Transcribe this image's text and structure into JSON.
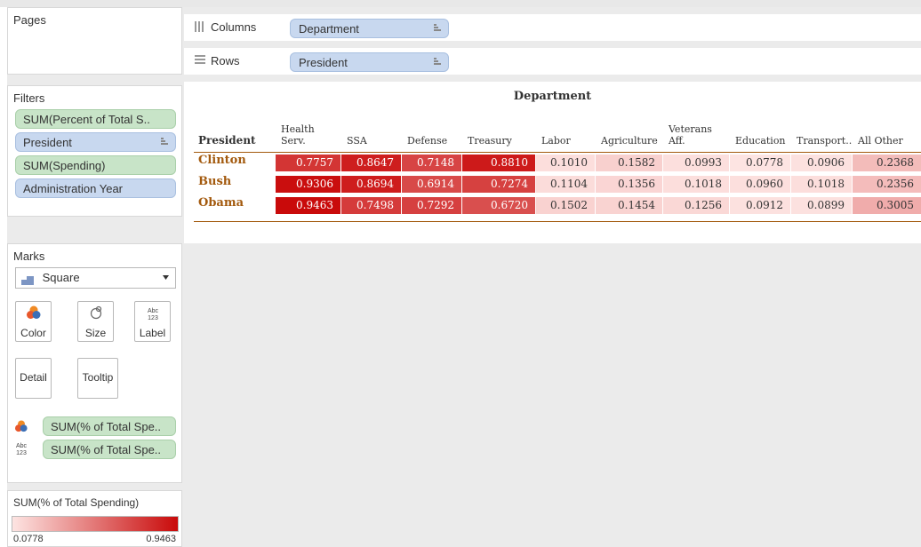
{
  "pages": {
    "title": "Pages"
  },
  "shelves": {
    "columns": {
      "label": "Columns",
      "pill": "Department"
    },
    "rows": {
      "label": "Rows",
      "pill": "President"
    }
  },
  "filters": {
    "title": "Filters",
    "items": [
      {
        "label": "SUM(Percent of Total S..",
        "kind": "measure"
      },
      {
        "label": "President",
        "kind": "dimension"
      },
      {
        "label": "SUM(Spending)",
        "kind": "measure"
      },
      {
        "label": "Administration Year",
        "kind": "dimension"
      }
    ]
  },
  "marks": {
    "title": "Marks",
    "mark_type": "Square",
    "buttons": {
      "color": "Color",
      "size": "Size",
      "label": "Label",
      "detail": "Detail",
      "tooltip": "Tooltip"
    },
    "label_icon_text": "Abc\n123",
    "fields": [
      {
        "label": "SUM(% of Total Spe..",
        "role": "color"
      },
      {
        "label": "SUM(% of Total Spe..",
        "role": "label"
      }
    ]
  },
  "legend": {
    "title": "SUM(% of Total Spending)",
    "min": "0.0778",
    "max": "0.9463",
    "color_low": "#fde4e2",
    "color_high": "#c90a0a"
  },
  "chart_data": {
    "type": "heatmap",
    "title": "Department",
    "row_header": "President",
    "columns": [
      "Health\nServ.",
      "SSA",
      "Defense",
      "Treasury",
      "Labor",
      "Agriculture",
      "Veterans\nAff.",
      "Education",
      "Transport..",
      "All Other"
    ],
    "rows": [
      {
        "name": "Clinton",
        "values": [
          "0.7757",
          "0.8647",
          "0.7148",
          "0.8810",
          "0.1010",
          "0.1582",
          "0.0993",
          "0.0778",
          "0.0906",
          "0.2368"
        ]
      },
      {
        "name": "Bush",
        "values": [
          "0.9306",
          "0.8694",
          "0.6914",
          "0.7274",
          "0.1104",
          "0.1356",
          "0.1018",
          "0.0960",
          "0.1018",
          "0.2356"
        ]
      },
      {
        "name": "Obama",
        "values": [
          "0.9463",
          "0.7498",
          "0.7292",
          "0.6720",
          "0.1502",
          "0.1454",
          "0.1256",
          "0.0912",
          "0.0899",
          "0.3005"
        ]
      }
    ],
    "color_range": [
      0.0778,
      0.9463
    ]
  }
}
